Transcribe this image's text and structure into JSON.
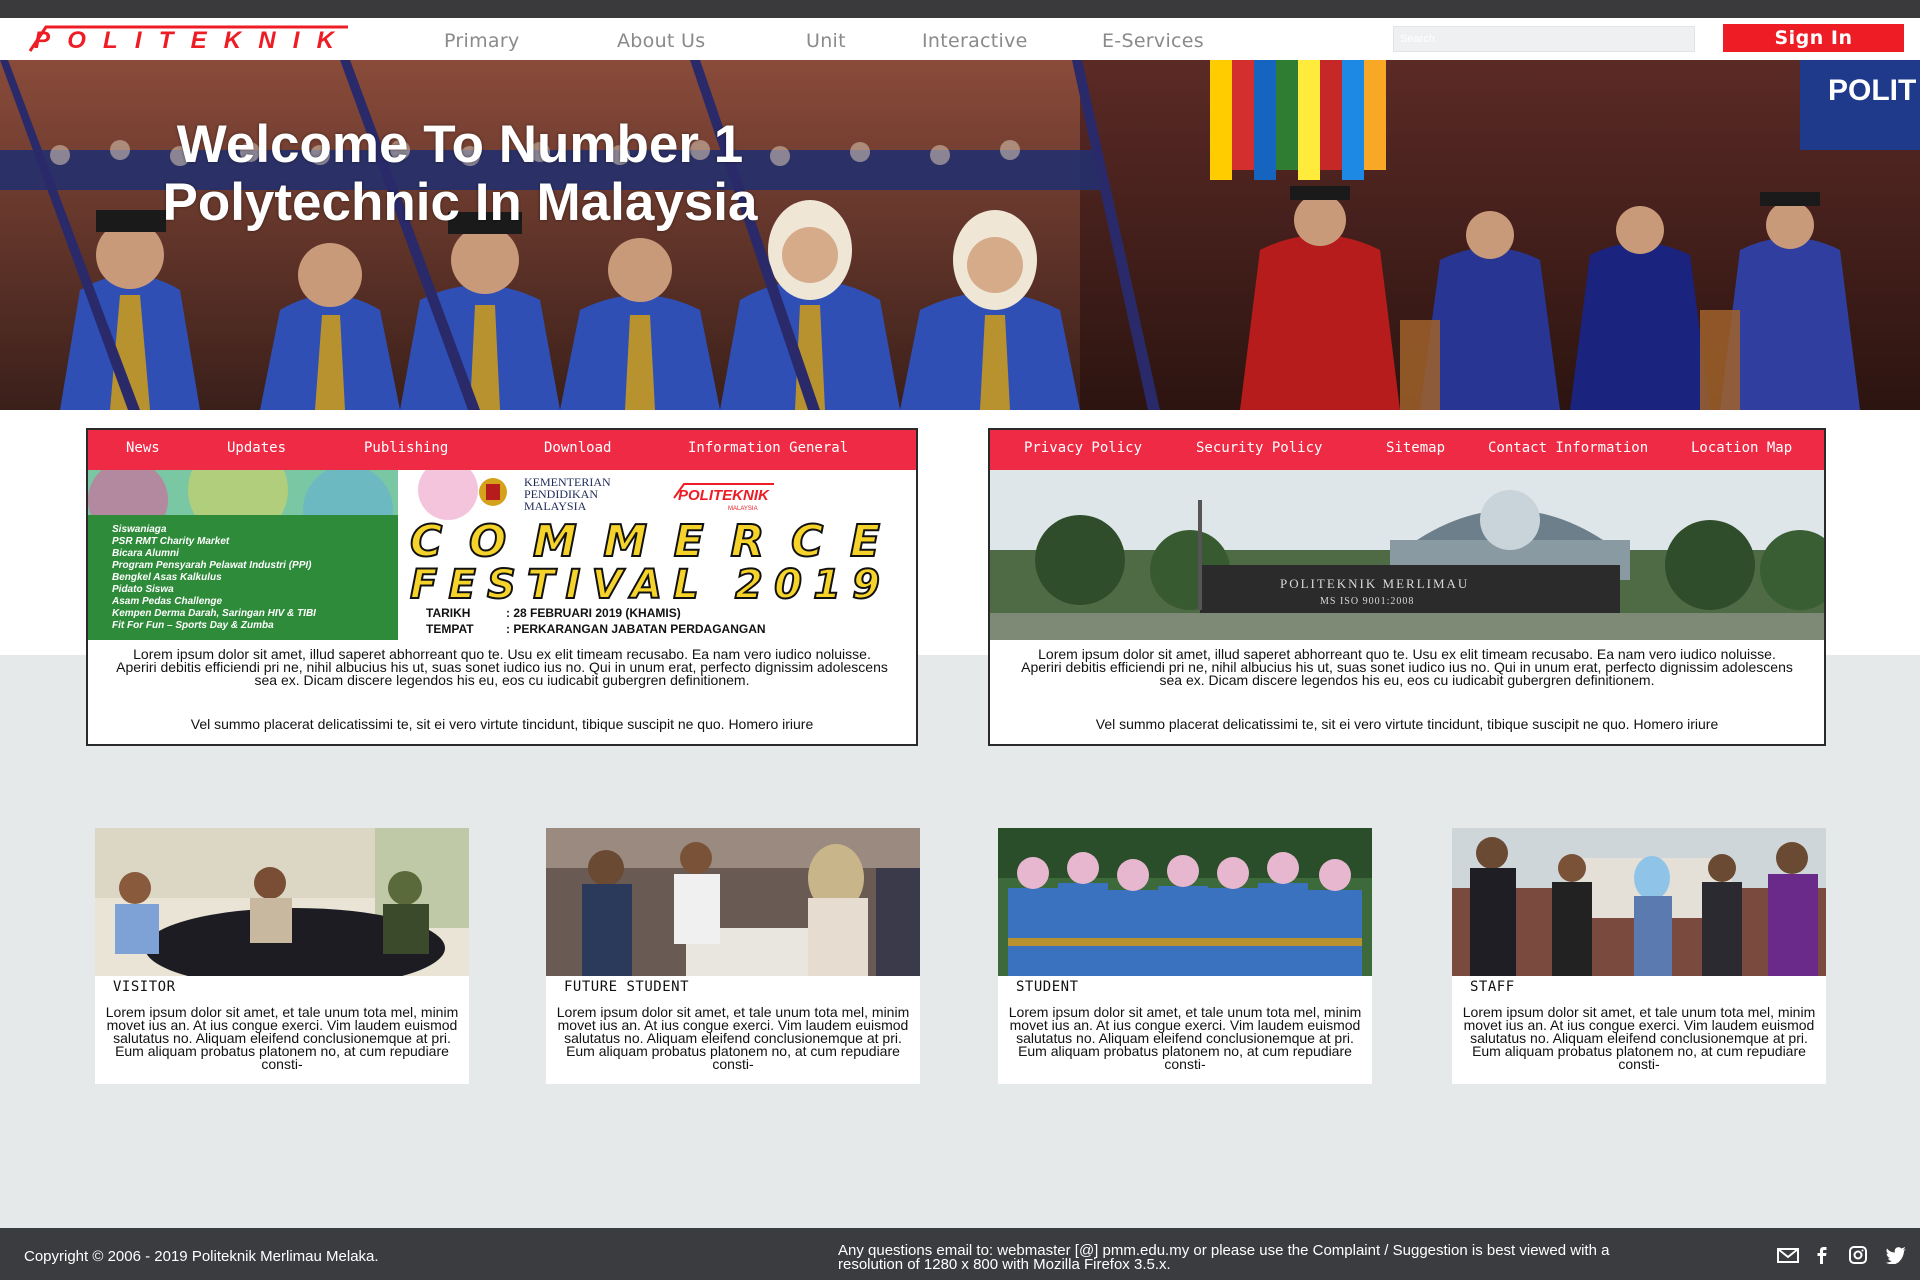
{
  "header": {
    "logo_text": "POLITEKNIK",
    "nav": [
      "Primary",
      "About Us",
      "Unit",
      "Interactive",
      "E-Services"
    ],
    "search_placeholder": "Search",
    "sign_in_label": "Sign In"
  },
  "hero": {
    "title": "Welcome To Number 1 Polytechnic In Malaysia"
  },
  "left_panel": {
    "tabs": [
      "News",
      "Updates",
      "Publishing",
      "Download",
      "Information General"
    ],
    "poster": {
      "ministry": [
        "KEMENTERIAN",
        "PENDIDIKAN",
        "MALAYSIA"
      ],
      "logo_text": "POLITEKNIK",
      "logo_sub": "MALAYSIA",
      "title_line1": "COMMERCE",
      "title_line2": "FESTIVAL 2019",
      "events": [
        "Siswaniaga",
        "PSR RMT Charity Market",
        "Bicara Alumni",
        "Program Pensyarah Pelawat Industri (PPI)",
        "Bengkel Asas Kalkulus",
        "Pidato Siswa",
        "Asam Pedas Challenge",
        "Kempen Derma Darah, Saringan HIV & TIBI",
        "Fit For Fun – Sports Day & Zumba"
      ],
      "tarikh_label": "TARIKH",
      "tarikh_value": ":  28 FEBRUARI 2019 (KHAMIS)",
      "tempat_label": "TEMPAT",
      "tempat_value": ":  PERKARANGAN JABATAN PERDAGANGAN"
    },
    "text": "Lorem ipsum dolor sit amet, illud saperet abhorreant quo te. Usu ex elit timeam recusabo. Ea nam vero iudico noluisse. Aperiri debitis efficiendi pri ne, nihil albucius his ut, suas sonet iudico ius no. Qui in unum erat, perfecto dignissim adolescens sea ex. Dicam discere legendos his eu, eos cu iudicabit gubergren definitionem.",
    "text2": "Vel summo placerat delicatissimi te, sit ei vero virtute tincidunt, tibique suscipit ne quo. Homero iriure"
  },
  "right_panel": {
    "tabs": [
      "Privacy Policy",
      "Security Policy",
      "Sitemap",
      "Contact Information",
      "Location Map"
    ],
    "sign_line1": "POLITEKNIK MERLIMAU",
    "sign_line2": "MS ISO 9001:2008",
    "text": "Lorem ipsum dolor sit amet, illud saperet abhorreant quo te. Usu ex elit timeam recusabo. Ea nam vero iudico noluisse. Aperiri debitis efficiendi pri ne, nihil albucius his ut, suas sonet iudico ius no. Qui in unum erat, perfecto dignissim adolescens sea ex. Dicam discere legendos his eu, eos cu iudicabit gubergren definitionem.",
    "text2": "Vel summo placerat delicatissimi te, sit ei vero virtute tincidunt, tibique suscipit ne quo. Homero iriure"
  },
  "cards": [
    {
      "label": "VISITOR",
      "text": "Lorem ipsum dolor sit amet, et tale unum tota mel, minim movet ius an. At ius congue exerci. Vim laudem euismod salutatus no. Aliquam eleifend conclusionemque at pri. Eum aliquam probatus platonem no, at cum repudiare consti-"
    },
    {
      "label": "FUTURE STUDENT",
      "text": "Lorem ipsum dolor sit amet, et tale unum tota mel, minim movet ius an. At ius congue exerci. Vim laudem euismod salutatus no. Aliquam eleifend conclusionemque at pri. Eum aliquam probatus platonem no, at cum repudiare consti-"
    },
    {
      "label": "STUDENT",
      "text": "Lorem ipsum dolor sit amet, et tale unum tota mel, minim movet ius an. At ius congue exerci. Vim laudem euismod salutatus no. Aliquam eleifend conclusionemque at pri. Eum aliquam probatus platonem no, at cum repudiare consti-"
    },
    {
      "label": "STAFF",
      "text": "Lorem ipsum dolor sit amet, et tale unum tota mel, minim movet ius an. At ius congue exerci. Vim laudem euismod salutatus no. Aliquam eleifend conclusionemque at pri. Eum aliquam probatus platonem no, at cum repudiare consti-"
    }
  ],
  "footer": {
    "copyright": "Copyright © 2006 - 2019 Politeknik Merlimau Melaka.",
    "questions": "Any questions email to: webmaster [@] pmm.edu.my or please use the Complaint / Suggestion is best viewed with a resolution of 1280 x 800 with Mozilla Firefox 3.5.x.",
    "social_icons": [
      "mail-icon",
      "facebook-icon",
      "instagram-icon",
      "twitter-icon"
    ]
  },
  "colors": {
    "brand_red": "#ee1c25",
    "tab_bar": "#ee2a45",
    "topbar": "#3a3a3d",
    "footer": "#3b3c3f",
    "gown_blue": "#2f4fb5"
  }
}
